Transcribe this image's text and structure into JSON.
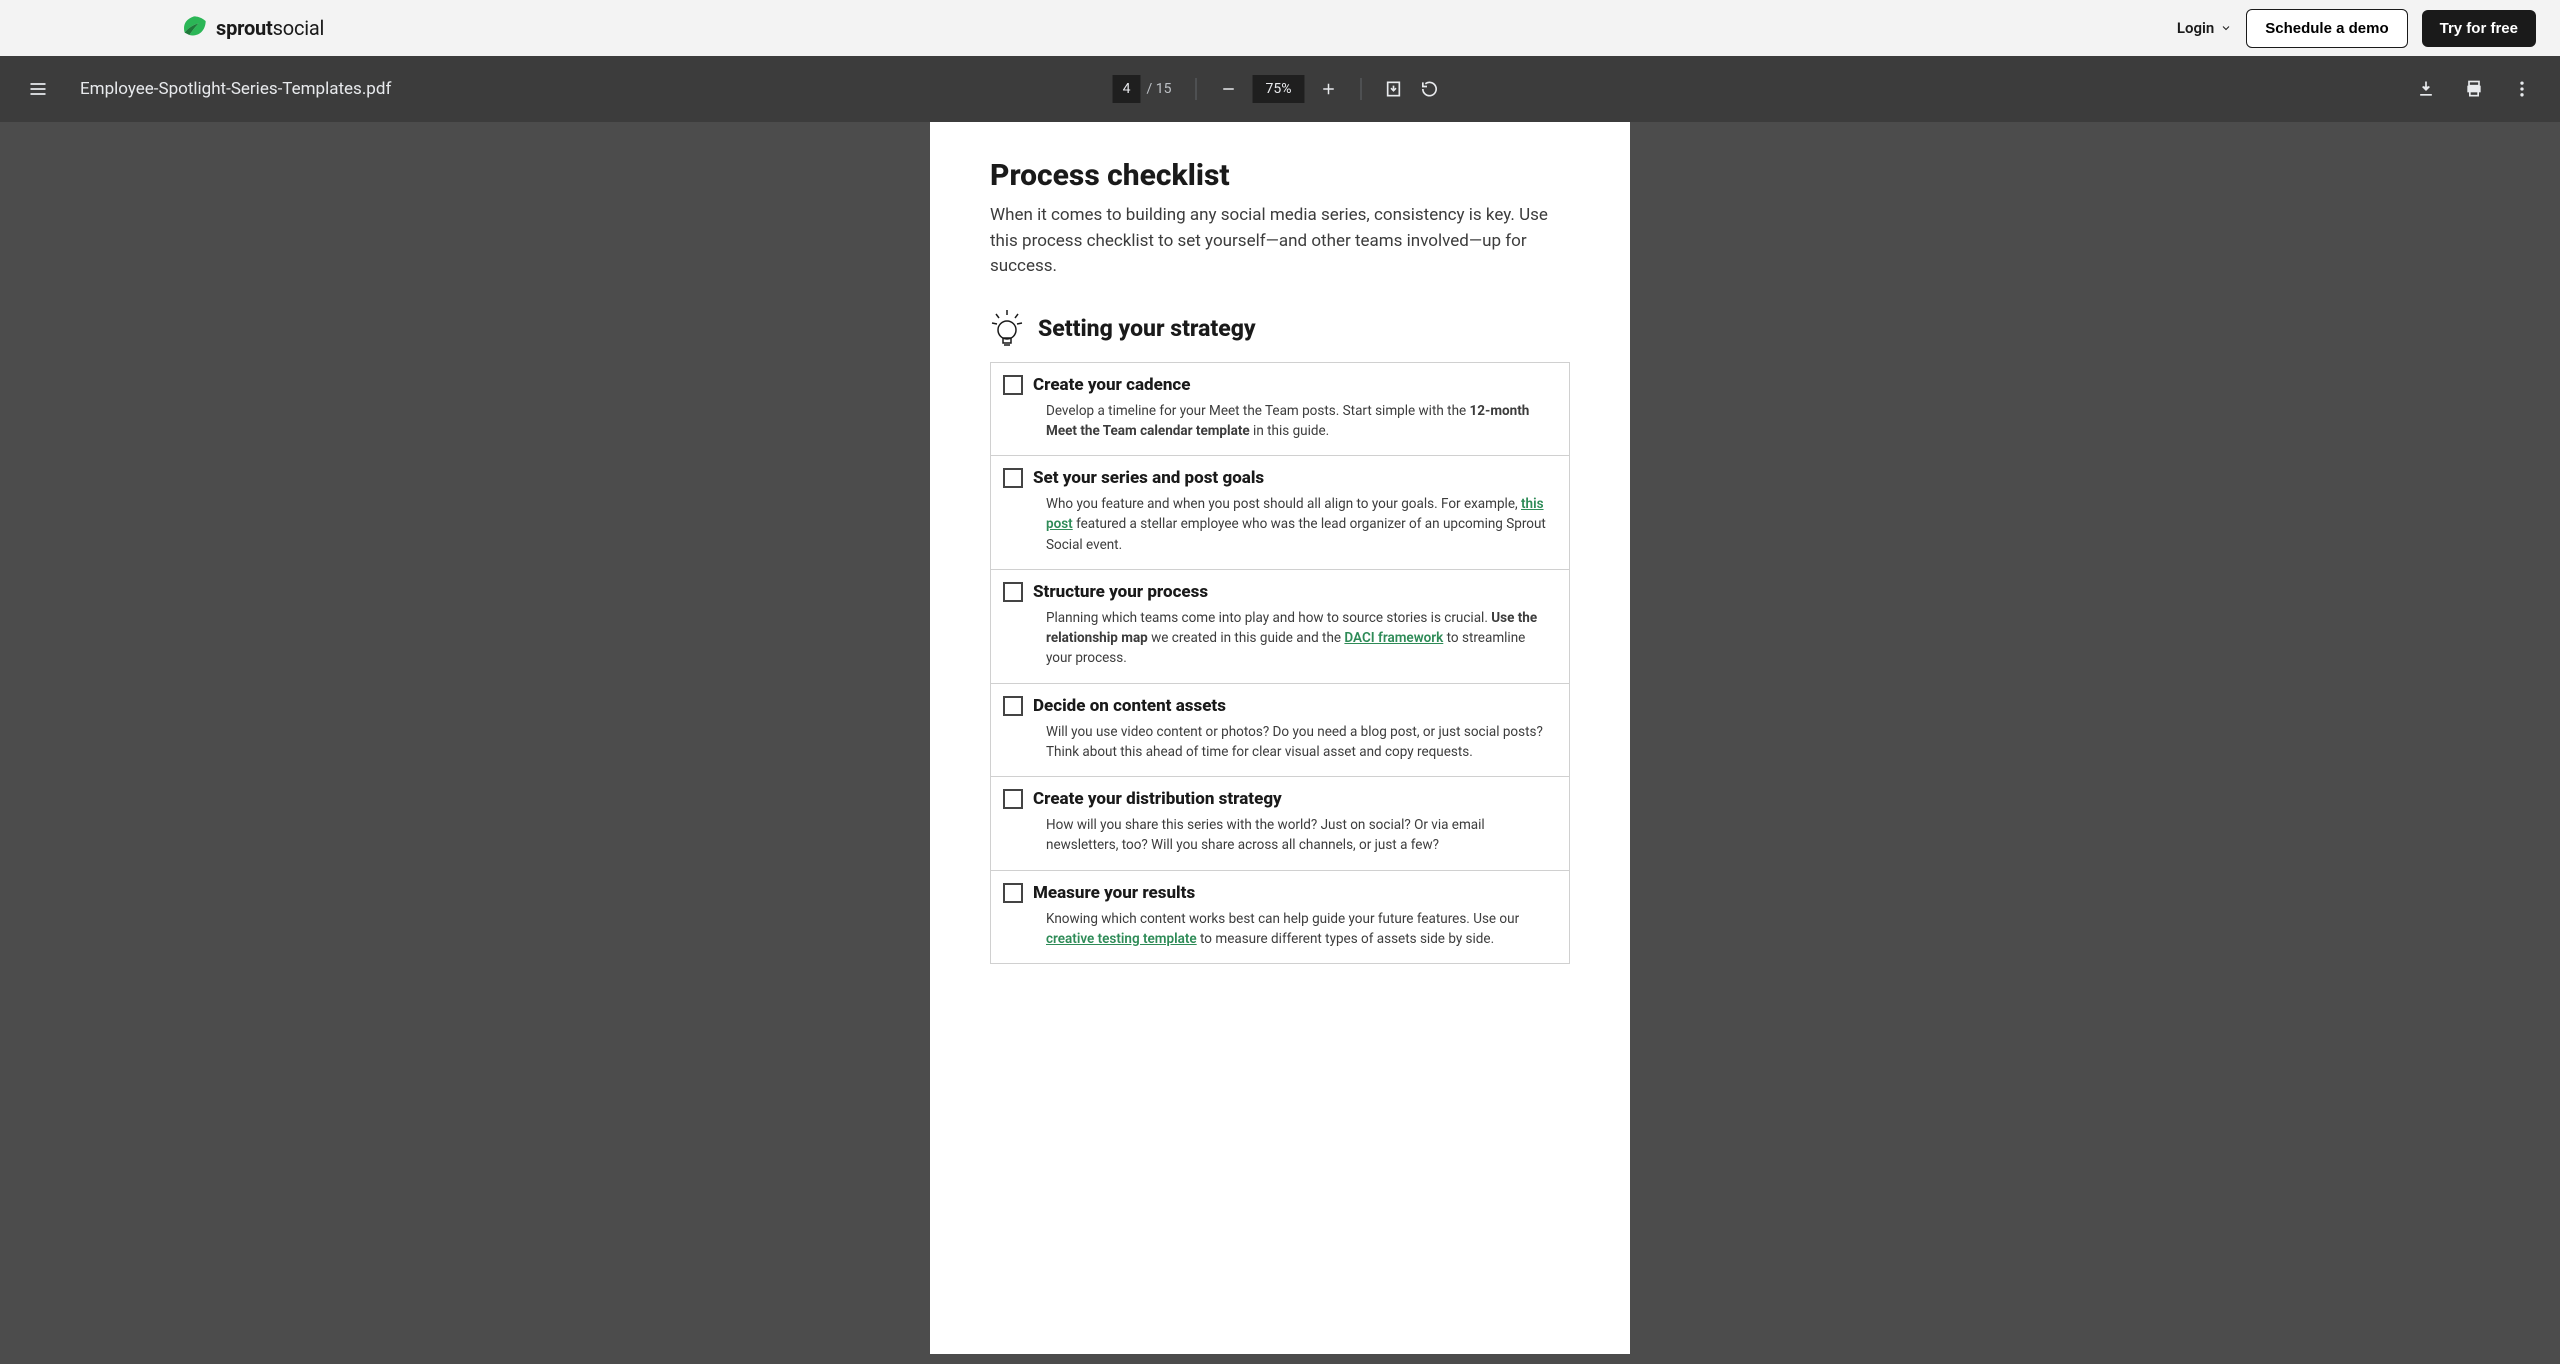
{
  "nav": {
    "brand_bold": "sprout",
    "brand_light": "social",
    "login": "Login",
    "schedule": "Schedule a demo",
    "try": "Try for free"
  },
  "pdf": {
    "filename": "Employee-Spotlight-Series-Templates.pdf",
    "page": "4",
    "pages": "/ 15",
    "zoom": "75%"
  },
  "doc": {
    "title": "Process checklist",
    "intro": "When it comes to building any social media series, consistency is key. Use this process checklist to set yourself—and other teams involved—up for success.",
    "section": "Setting your strategy",
    "items": [
      {
        "title": "Create your cadence",
        "body_pre": "Develop a timeline for your Meet the Team posts. Start simple with the ",
        "body_strong": "12-month Meet the Team calendar template",
        "body_post": " in this guide."
      },
      {
        "title": "Set your series and post goals",
        "body_pre": "Who you feature and when you post should all align to your goals. For example, ",
        "link": "this post",
        "body_post": " featured a stellar employee who was the lead organizer of an upcoming Sprout Social event."
      },
      {
        "title": "Structure your process",
        "body_pre": "Planning which teams come into play and how to source stories is crucial. ",
        "body_strong": "Use the relationship map",
        "body_mid": " we created in this guide and the ",
        "link": "DACI framework",
        "body_post": " to streamline your process."
      },
      {
        "title": "Decide on content assets",
        "body_plain": "Will you use video content or photos? Do you need a blog post, or just social posts? Think about this ahead of time for clear visual asset and copy requests."
      },
      {
        "title": "Create your distribution strategy",
        "body_plain": "How will you share this series with the world? Just on social? Or via email newsletters, too? Will you share across all channels, or just a few?"
      },
      {
        "title": "Measure your results",
        "body_pre": "Knowing which content works best can help guide your future features. Use our ",
        "link": "creative testing template",
        "body_post": " to measure different types of assets side by side."
      }
    ]
  }
}
